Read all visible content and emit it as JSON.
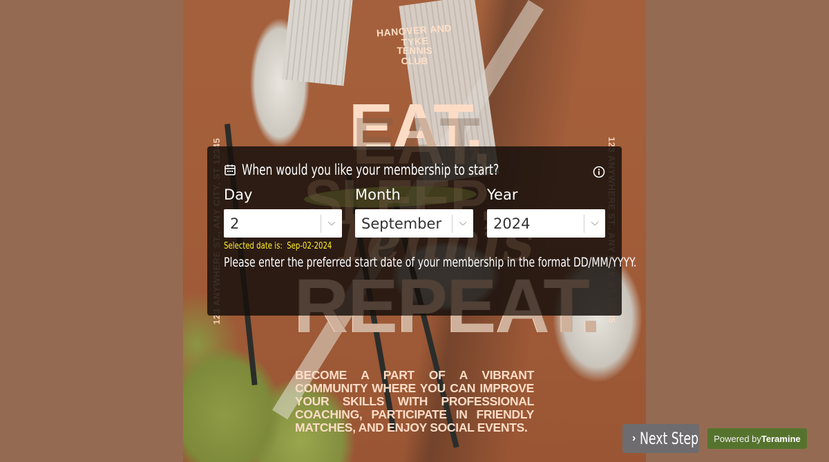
{
  "poster": {
    "club_arc": "HANOVER AND TYKE",
    "club_name_line1": "TENNIS",
    "club_name_line2": "CLUB",
    "headline_top": "EAT,",
    "headline_mid1": "SLEEP,",
    "headline_mid2": "Tennis",
    "headline_bottom": "REPEAT.",
    "address": "123 ANYWHERE ST., ANY CITY, ST 12345",
    "tagline": "BECOME A PART OF A VIBRANT COMMUNITY WHERE YOU CAN IMPROVE YOUR SKILLS WITH PROFESSIONAL COACHING, PARTICIPATE IN FRIENDLY MATCHES, AND ENJOY SOCIAL EVENTS."
  },
  "form": {
    "question": "When would you like your membership to start?",
    "question_icon": "calendar-icon",
    "info_icon": "info-icon",
    "fields": [
      {
        "label": "Day",
        "value": "2"
      },
      {
        "label": "Month",
        "value": "September"
      },
      {
        "label": "Year",
        "value": "2024"
      }
    ],
    "selected_date_label": "Selected date is:",
    "selected_date_value": "Sep-02-2024",
    "helper_text": "Please enter the preferred start date of your membership in the format DD/MM/YYYY."
  },
  "footer": {
    "next_label": "Next Step",
    "powered_prefix": "Powered by",
    "powered_brand": "Teramine"
  },
  "colors": {
    "page_bg": "#946b52",
    "selected_date": "#ffef2a",
    "next_button": "#6e6c6e",
    "powered_badge": "#56732e",
    "poster_text": "#fddcc6"
  }
}
